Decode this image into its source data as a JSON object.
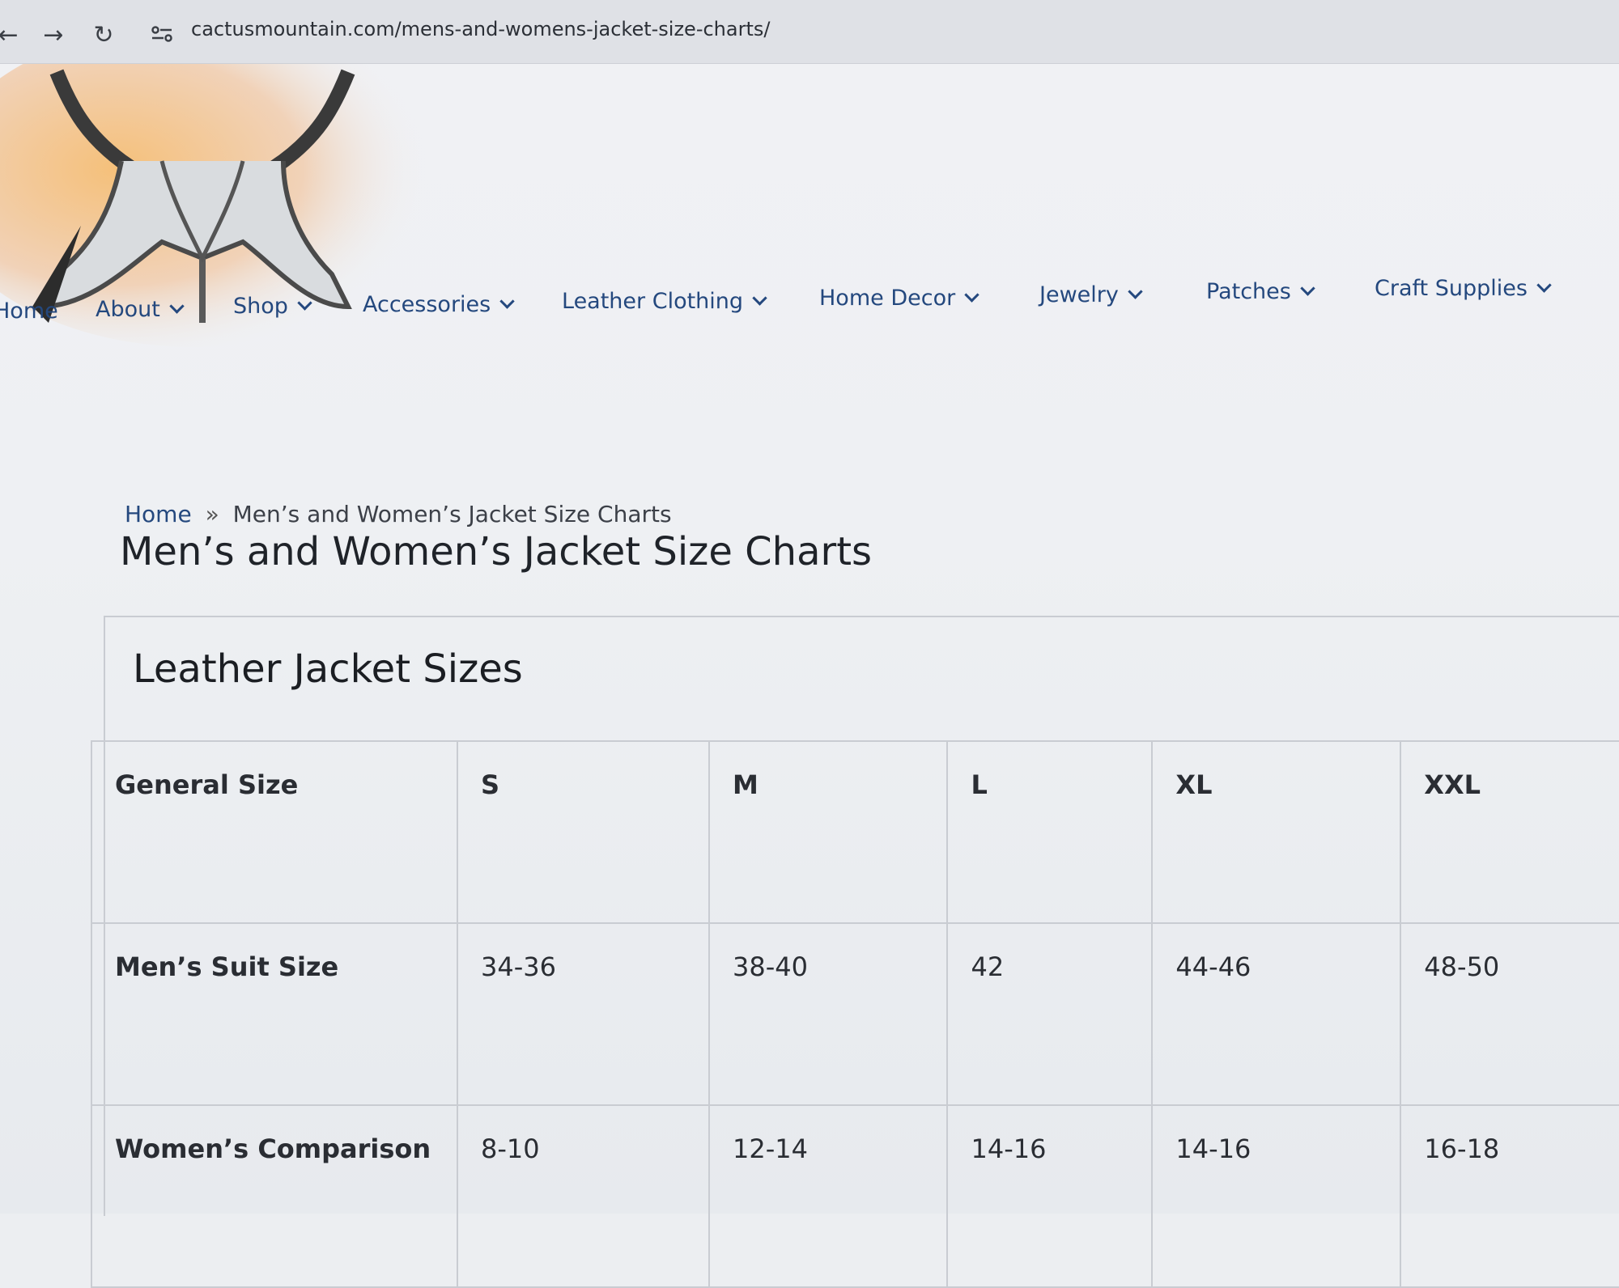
{
  "browser": {
    "url": "cactusmountain.com/mens-and-womens-jacket-size-charts/",
    "back_icon": "←",
    "forward_icon": "→",
    "reload_icon": "↻"
  },
  "nav": {
    "items": [
      {
        "label": "Home",
        "has_dropdown": false
      },
      {
        "label": "About",
        "has_dropdown": true
      },
      {
        "label": "Shop",
        "has_dropdown": true
      },
      {
        "label": "Accessories",
        "has_dropdown": true
      },
      {
        "label": "Leather Clothing",
        "has_dropdown": true
      },
      {
        "label": "Home Decor",
        "has_dropdown": true
      },
      {
        "label": "Jewelry",
        "has_dropdown": true
      },
      {
        "label": "Patches",
        "has_dropdown": true
      },
      {
        "label": "Craft Supplies",
        "has_dropdown": true
      }
    ]
  },
  "breadcrumb": {
    "home": "Home",
    "separator": "»",
    "current": "Men’s and Women’s Jacket Size Charts"
  },
  "page_title": "Men’s and Women’s Jacket Size Charts",
  "size_panel": {
    "title": "Leather Jacket Sizes",
    "header": [
      "General Size",
      "S",
      "M",
      "L",
      "XL",
      "XXL"
    ],
    "rows": [
      [
        "Men’s Suit Size",
        "34-36",
        "38-40",
        "42",
        "44-46",
        "48-50"
      ],
      [
        "Women’s Comparison",
        "8-10",
        "12-14",
        "14-16",
        "14-16",
        "16-18"
      ]
    ]
  },
  "colors": {
    "nav_link": "#24487e",
    "text": "#1f2329",
    "border": "#c9ccd2"
  }
}
